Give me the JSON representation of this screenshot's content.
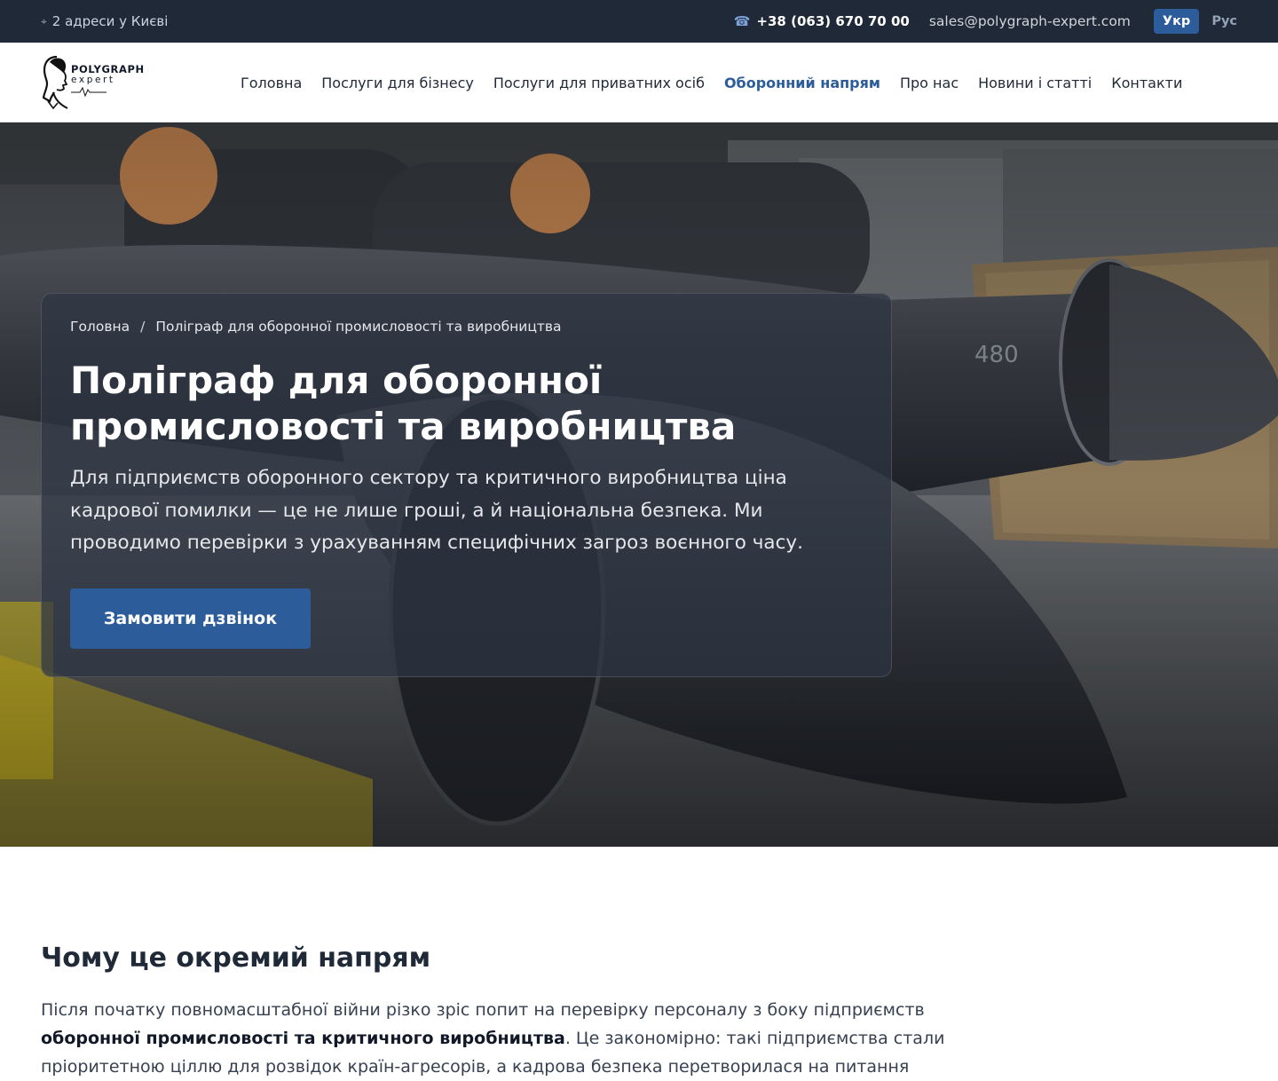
{
  "topbar": {
    "address": "2 адреси у Києві",
    "phone": "+38 (063) 670 70 00",
    "email": "sales@polygraph-expert.com",
    "languages": [
      {
        "label": "Укр",
        "active": true
      },
      {
        "label": "Рус",
        "active": false
      }
    ]
  },
  "logo": {
    "title": "POLYGRAPH",
    "subtitle": "expert"
  },
  "nav": {
    "items": [
      {
        "label": "Головна"
      },
      {
        "label": "Послуги для бізнесу"
      },
      {
        "label": "Послуги для приватних осіб"
      },
      {
        "label": "Оборонний напрям",
        "active": true
      },
      {
        "label": "Про нас"
      },
      {
        "label": "Новини і статті"
      },
      {
        "label": "Контакти"
      }
    ]
  },
  "hero": {
    "breadcrumb": {
      "home": "Головна",
      "separator": "/",
      "current": "Поліграф для оборонної промисловості та виробництва"
    },
    "title": "Поліграф для оборонної промисловості та виробництва",
    "text": "Для підприємств оборонного сектору та критичного виробництва ціна кадрової помилки — це не лише гроші, а й національна безпека. Ми проводимо перевірки з урахуванням специфічних загроз воєнного часу.",
    "button": "Замовити дзвінок",
    "image_marking": "480"
  },
  "section": {
    "heading": "Чому це окремий напрям",
    "paragraph_start": "Після початку повномасштабної війни різко зріс попит на перевірку персоналу з боку підприємств ",
    "paragraph_bold": "оборонної промисловості та критичного виробництва",
    "paragraph_end": ". Це закономірно: такі підприємства стали пріоритетною ціллю для розвідок країн-агресорів, а кадрова безпека перетворилася на питання"
  },
  "colors": {
    "topbar_bg": "#1f2937",
    "accent": "#2c5c99",
    "nav_active": "#2c5c99"
  },
  "icons": {
    "address": "location-pin-icon",
    "phone": "phone-icon"
  }
}
